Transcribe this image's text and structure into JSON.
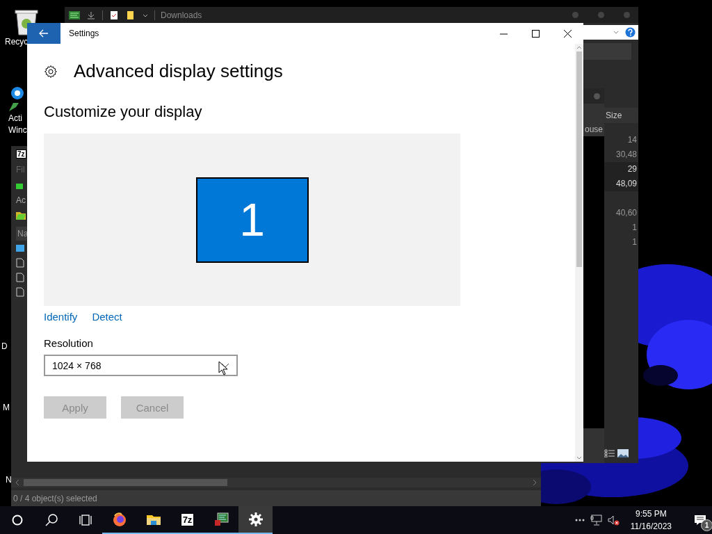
{
  "desktop_icons": [
    {
      "kind": "recycle",
      "lines": [
        "Recyc"
      ]
    },
    {
      "kind": "activate",
      "lines": [
        "Acti",
        "Winc"
      ]
    },
    {
      "kind": "none",
      "lines": [
        "D"
      ]
    },
    {
      "kind": "none",
      "lines": [
        "M"
      ]
    },
    {
      "kind": "none",
      "lines": [
        "N"
      ]
    }
  ],
  "explorer_window": {
    "title": "Downloads",
    "column_header": "Size",
    "dialog_cut_text": "ouse",
    "sizes": [
      {
        "value": "14",
        "selected": false
      },
      {
        "value": "30,48",
        "selected": false
      },
      {
        "value": "29",
        "selected": true
      },
      {
        "value": "48,09",
        "selected": true
      },
      {
        "value": "40,60",
        "selected": false
      },
      {
        "value": "1",
        "selected": false
      },
      {
        "value": "1",
        "selected": false
      }
    ]
  },
  "archive_window": {
    "logo": "7z",
    "menu_cut": "Fil",
    "toolbar_cut": "Ac",
    "column_cut": "Na",
    "files": [
      {
        "kind": "folder"
      },
      {
        "kind": "file"
      },
      {
        "kind": "file"
      },
      {
        "kind": "file"
      }
    ],
    "status": "0 / 4 object(s) selected"
  },
  "settings_window": {
    "title": "Settings",
    "heading": "Advanced display settings",
    "section": "Customize your display",
    "monitor_label": "1",
    "links": [
      "Identify",
      "Detect"
    ],
    "resolution_label": "Resolution",
    "resolution_value": "1024 × 768",
    "buttons": [
      {
        "label": "Apply",
        "disabled": true
      },
      {
        "label": "Cancel",
        "disabled": true
      }
    ]
  },
  "taskbar": {
    "apps": [
      {
        "kind": "cortana",
        "running": false,
        "active": false
      },
      {
        "kind": "search",
        "running": false,
        "active": false
      },
      {
        "kind": "taskview",
        "running": false,
        "active": false
      },
      {
        "kind": "firefox",
        "running": true,
        "active": false
      },
      {
        "kind": "folder",
        "running": true,
        "active": false
      },
      {
        "kind": "archiver",
        "label": "7z",
        "running": true,
        "active": false
      },
      {
        "kind": "monitor",
        "running": true,
        "active": false
      },
      {
        "kind": "gear",
        "running": true,
        "active": true
      }
    ],
    "time": "9:55 PM",
    "date": "11/16/2023",
    "notification_count": "1"
  }
}
